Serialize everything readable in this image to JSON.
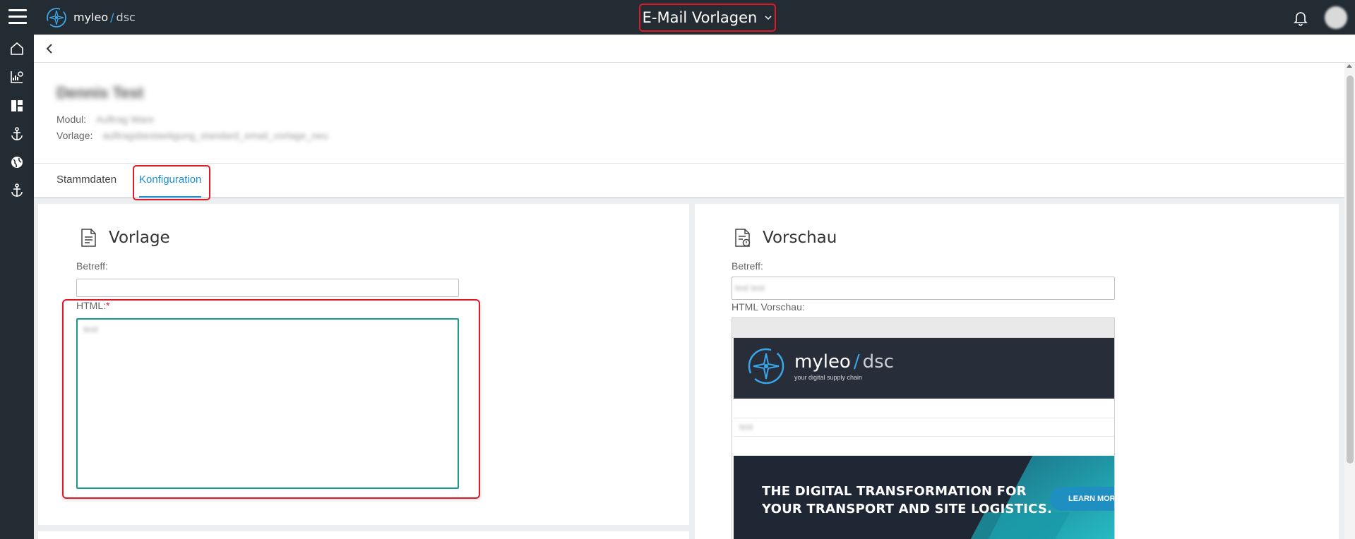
{
  "app": {
    "brand_name": "myleo",
    "brand_slash": "/",
    "brand_suffix": "dsc",
    "page_title": "E-Mail Vorlagen"
  },
  "details": {
    "name": "Dennis Test",
    "module_label": "Modul:",
    "module_value": "Auftrag Ware",
    "template_label": "Vorlage:",
    "template_value": "auftragsbestaetigung_standard_email_vorlage_neu"
  },
  "tabs": [
    {
      "label": "Stammdaten",
      "active": false
    },
    {
      "label": "Konfiguration",
      "active": true
    }
  ],
  "vorlage": {
    "title": "Vorlage",
    "subject_label": "Betreff:",
    "subject_value": "",
    "html_label": "HTML:",
    "html_required": "*",
    "html_value": "test"
  },
  "vorschau": {
    "title": "Vorschau",
    "subject_label": "Betreff:",
    "subject_value": "test test",
    "html_label": "HTML Vorschau:",
    "email": {
      "brand_name": "myleo",
      "brand_slash": "/",
      "brand_suffix": "dsc",
      "tagline": "your digital supply chain",
      "body_text": "test",
      "headline_line1": "THE DIGITAL TRANSFORMATION FOR",
      "headline_line2": "YOUR TRANSPORT AND SITE LOGISTICS.",
      "cta_label": "LEARN MORE"
    }
  },
  "colors": {
    "topbar": "#232b33",
    "accent": "#1a8fd8",
    "highlight": "#e0192a",
    "focus": "#1a9a8e"
  }
}
